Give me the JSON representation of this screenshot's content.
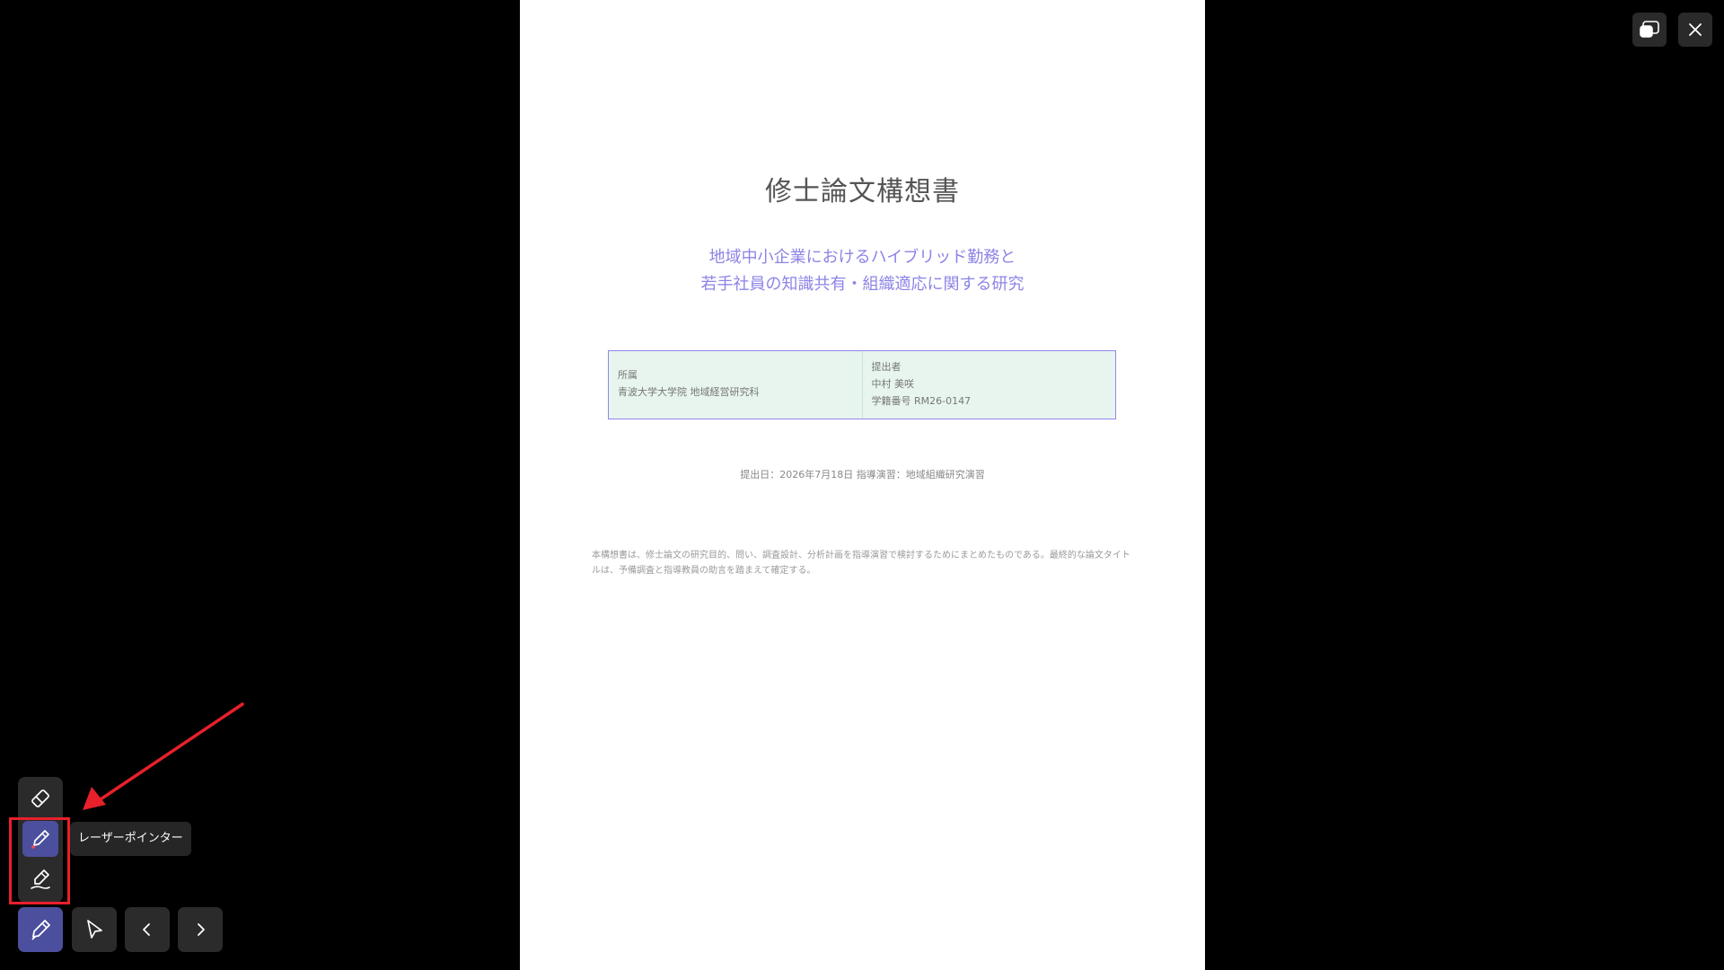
{
  "slide": {
    "title": "修士論文構想書",
    "subtitle_line1": "地域中小企業におけるハイブリッド勤務と",
    "subtitle_line2": "若手社員の知識共有・組織適応に関する研究",
    "affiliation_label": "所属",
    "affiliation_value": "青波大学大学院 地域経営研究科",
    "submitter_label": "提出者",
    "submitter_name": "中村 美咲",
    "student_id": "学籍番号 RM26-0147",
    "date_line": "提出日：2026年7月18日 指導演習：地域組織研究演習",
    "note": "本構想書は、修士論文の研究目的、問い、調査設計、分析計画を指導演習で検討するためにまとめたものである。最終的な論文タイトルは、予備調査と指導教員の助言を踏まえて確定する。"
  },
  "tooltip": {
    "label": "レーザーポインター"
  },
  "colors": {
    "accent": "#4b4f9d",
    "subtitle": "#8c84e6",
    "info_bg": "#e7f5ee",
    "highlight": "#e8202a"
  },
  "icons": {
    "window_switch": "window-switch-icon",
    "close": "close-icon",
    "eraser": "eraser-icon",
    "laser_pointer": "laser-pointer-icon",
    "highlighter": "highlighter-icon",
    "pen": "pen-icon",
    "cursor": "cursor-arrow-icon",
    "prev": "chevron-left-icon",
    "next": "chevron-right-icon"
  }
}
